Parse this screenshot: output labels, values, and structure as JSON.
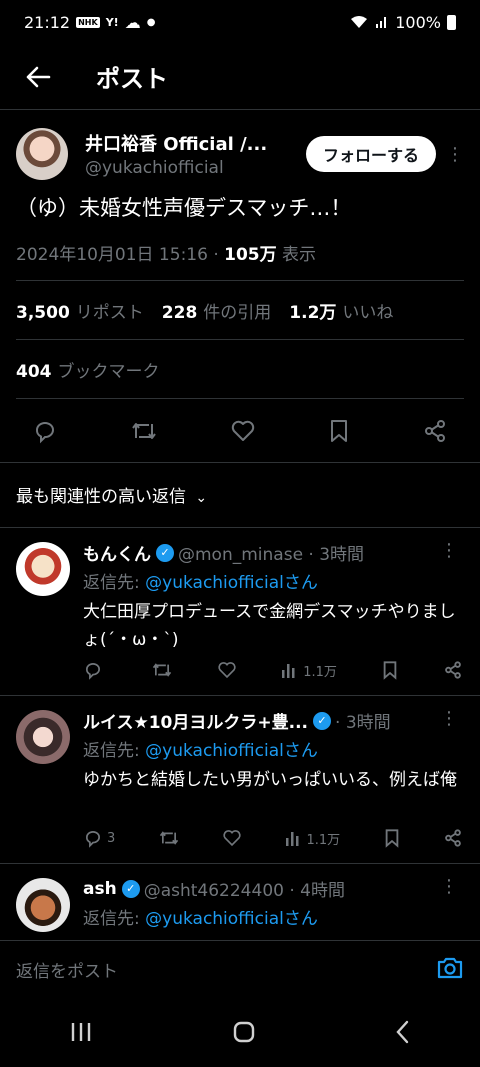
{
  "status": {
    "time": "21:12",
    "battery": "100%",
    "nhk": "NHK",
    "y": "Y!"
  },
  "header": {
    "title": "ポスト"
  },
  "post": {
    "author_name": "井口裕香 Official /...",
    "author_handle": "@yukachiofficial",
    "follow_label": "フォローする",
    "text": "（ゆ）未婚女性声優デスマッチ…！",
    "datetime": "2024年10月01日 15:16 · ",
    "views": "105万",
    "views_label": " 表示",
    "reposts": "3,500",
    "reposts_label": "リポスト",
    "quotes": "228",
    "quotes_label": "件の引用",
    "likes": "1.2万",
    "likes_label": "いいね",
    "bookmarks": "404",
    "bookmarks_label": "ブックマーク"
  },
  "sort_label": "最も関連性の高い返信",
  "replies": [
    {
      "name": "もんくん",
      "handle": "@mon_minase · 3時間",
      "reply_prefix": "返信先: ",
      "reply_to": "@yukachiofficialさん",
      "body": "大仁田厚プロデュースで金網デスマッチやりましょ(´・ω・`)",
      "comments": "",
      "views": "1.1万"
    },
    {
      "name": "ルイス★10月ヨルクラ+豊...",
      "handle": "· 3時間",
      "reply_prefix": "返信先: ",
      "reply_to": "@yukachiofficialさん",
      "body": "ゆかちと結婚したい男がいっぱいいる、例えば俺",
      "comments": "3",
      "views": "1.1万"
    },
    {
      "name": "ash",
      "handle": "@asht46224400 · 4時間",
      "reply_prefix": "返信先: ",
      "reply_to": "@yukachiofficialさん"
    }
  ],
  "compose": {
    "placeholder": "返信をポスト"
  },
  "colors": {
    "accent": "#1d9bf0",
    "muted": "#71767b",
    "background": "#000000"
  }
}
